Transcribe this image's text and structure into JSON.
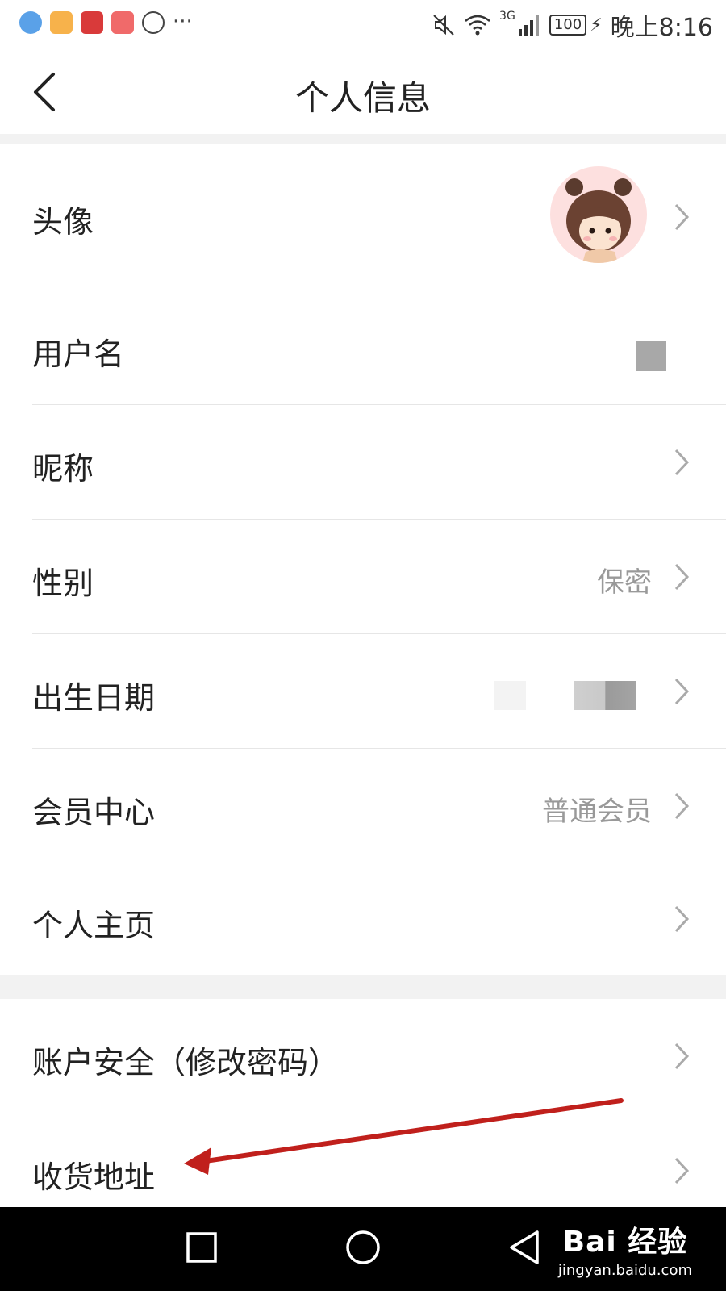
{
  "status_bar": {
    "time": "晚上8:16",
    "battery": "100",
    "network": "3G"
  },
  "header": {
    "title": "个人信息"
  },
  "rows": [
    {
      "label": "头像",
      "value": ""
    },
    {
      "label": "用户名",
      "value": ""
    },
    {
      "label": "昵称",
      "value": ""
    },
    {
      "label": "性别",
      "value": "保密"
    },
    {
      "label": "出生日期",
      "value": ""
    },
    {
      "label": "会员中心",
      "value": "普通会员"
    },
    {
      "label": "个人主页",
      "value": ""
    },
    {
      "label": "账户安全（修改密码）",
      "value": ""
    },
    {
      "label": "收货地址",
      "value": ""
    }
  ],
  "watermark": {
    "brand": "Bai  经验",
    "url": "jingyan.baidu.com"
  },
  "icons": {
    "back": "chevron-left-icon",
    "row_arrow": "chevron-right-icon",
    "nav": [
      "square-icon",
      "circle-icon",
      "triangle-back-icon"
    ]
  },
  "colors": {
    "annotation_arrow": "#c0201c",
    "separator": "#f2f2f2",
    "secondary_text": "#999999"
  }
}
